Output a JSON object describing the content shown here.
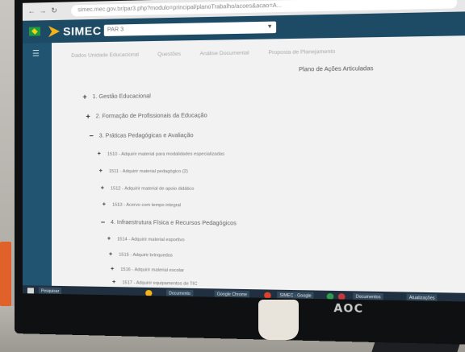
{
  "browser": {
    "url": "simec.mec.gov.br/par3.php?modulo=principal/planoTrabalho/acoes&acao=A..."
  },
  "header": {
    "logo_text": "SIMEC",
    "search_value": "PAR 3"
  },
  "tabs": [
    "Dados Unidade Educacional",
    "Questões",
    "Análise Documental",
    "Proposta de Planejamento"
  ],
  "content": {
    "title": "Plano de Ações Articuladas",
    "tree": [
      {
        "level": 1,
        "icon": "plus",
        "label": "1. Gestão Educacional"
      },
      {
        "level": 1,
        "icon": "plus",
        "label": "2. Formação de Profissionais da Educação"
      },
      {
        "level": 1,
        "icon": "minus",
        "label": "3. Práticas Pedagógicas e Avaliação"
      },
      {
        "level": 2,
        "icon": "plus",
        "label": "1510 - Adquirir material para modalidades especializadas"
      },
      {
        "level": 2,
        "icon": "plus",
        "label": "1511 - Adquirir material pedagógico (2)"
      },
      {
        "level": 2,
        "icon": "plus",
        "label": "1512 - Adquirir material de apoio didático"
      },
      {
        "level": 2,
        "icon": "plus",
        "label": "1513 - Acervo com tempo integral"
      },
      {
        "level": 1,
        "icon": "minus",
        "label": "4. Infraestrutura Física e Recursos Pedagógicos"
      },
      {
        "level": 2,
        "icon": "plus",
        "label": "1514 - Adquirir material esportivo"
      },
      {
        "level": 2,
        "icon": "plus",
        "label": "1515 - Adquirir brinquedos"
      },
      {
        "level": 2,
        "icon": "plus",
        "label": "1516 - Adquirir material escolar"
      },
      {
        "level": 2,
        "icon": "plus",
        "label": "1517 - Adquirir equipamentos de TIC"
      }
    ]
  },
  "taskbar": {
    "items": [
      "Pesquisar",
      "Documento",
      "Google Chrome",
      "SIMEC - Google",
      "Documentos",
      "Atualizações"
    ]
  },
  "monitor": {
    "brand": "AOC"
  },
  "colors": {
    "header_bg": "#1d4a64",
    "rail_bg": "#215470",
    "logo_accent": "#f3b416"
  }
}
